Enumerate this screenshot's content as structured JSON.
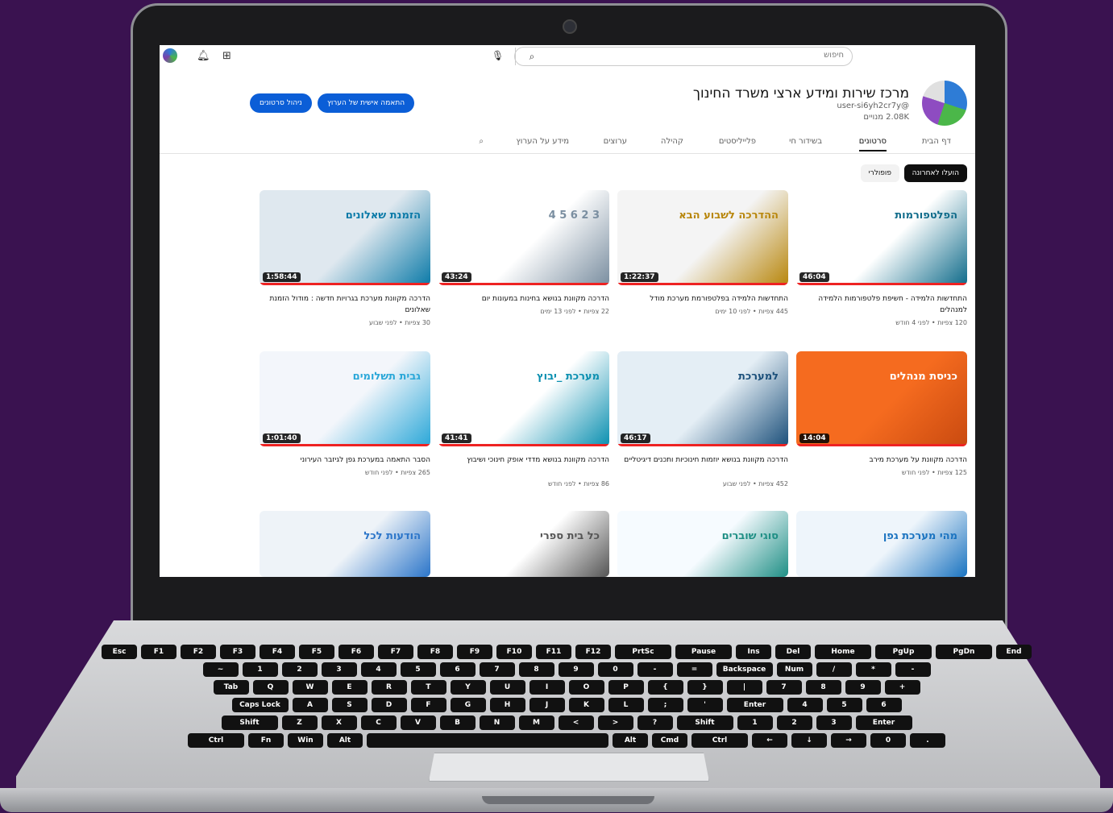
{
  "topbar": {
    "search_placeholder": "חיפוש",
    "icons": [
      "create-video-icon",
      "bell-icon",
      "mic-icon",
      "search-icon"
    ]
  },
  "channel": {
    "name": "מרכז שירות ומידע ארצי משרד החינוך",
    "handle": "@user-si6yh2cr7y",
    "subscribers": "2.08K מנויים",
    "customize_button": "התאמה אישית של הערוץ",
    "manage_button": "ניהול סרטונים"
  },
  "tabs": [
    {
      "label": "דף הבית"
    },
    {
      "label": "סרטונים"
    },
    {
      "label": "בשידור חי"
    },
    {
      "label": "פלייליסטים"
    },
    {
      "label": "קהילה"
    },
    {
      "label": "ערוצים"
    },
    {
      "label": "מידע על הערוץ"
    }
  ],
  "chips": {
    "latest": "הועלו לאחרונה",
    "popular": "פופולרי"
  },
  "videos": [
    {
      "title": "התחדשות הלמידה - חשיפת פלטפורמות הלמידה למנהלים",
      "meta": "120 צפיות • לפני 4 חודש",
      "duration": "46:04",
      "thumb_text": "הפלטפורמות"
    },
    {
      "title": "התחדשות הלמידה בפלטפורמת מערכת מודל",
      "meta": "445 צפיות • לפני 10 ימים",
      "duration": "1:22:37",
      "thumb_text": "ההדרכה לשבוע הבא"
    },
    {
      "title": "הדרכה מקוונת בנושא בחינות במעונות יום",
      "meta": "22 צפיות • לפני 13 ימים",
      "duration": "43:24",
      "thumb_text": "3 2 6 5 4"
    },
    {
      "title": "הדרכה מקוונת מערכת בגרויות חדשה : מודול הזמנת שאלונים",
      "meta": "30 צפיות • לפני שבוע",
      "duration": "1:58:44",
      "thumb_text": "הזמנת שאלונים"
    },
    {
      "title": "הדרכה מקוונת על מערכת מירב",
      "meta": "125 צפיות • לפני חודש",
      "duration": "14:04",
      "thumb_text": "כניסת מנהלים"
    },
    {
      "title": "הדרכה מקוונת בנושא יוזמות חינוכיות ותכנים דיגיטליים",
      "meta": "452 צפיות • לפני שבוע",
      "duration": "46:17",
      "thumb_text": "למערכת"
    },
    {
      "title": "הדרכה מקוונת בנושא מדדי אופק חינוכי ושיבוץ",
      "meta": "86 צפיות • לפני חודש",
      "duration": "41:41",
      "thumb_text": "מערכת _יבוץ"
    },
    {
      "title": "הסבר התאמה במערכת גפן לגיזבר העירוני",
      "meta": "265 צפיות • לפני חודש",
      "duration": "1:01:40",
      "thumb_text": "גבית תשלומים"
    },
    {
      "title": "",
      "meta": "",
      "duration": "",
      "thumb_text": "מהי מערכת גפן"
    },
    {
      "title": "",
      "meta": "",
      "duration": "",
      "thumb_text": "סוגי שוברים"
    },
    {
      "title": "",
      "meta": "",
      "duration": "",
      "thumb_text": "כל בית ספרי"
    },
    {
      "title": "",
      "meta": "",
      "duration": "",
      "thumb_text": "הודעות לכל"
    }
  ],
  "keyboard": {
    "row1": [
      "Esc",
      "F1",
      "F2",
      "F3",
      "F4",
      "F5",
      "F6",
      "F7",
      "F8",
      "F9",
      "F10",
      "F11",
      "F12",
      "PrtSc",
      "Pause",
      "Ins",
      "Del",
      "Home",
      "PgUp",
      "PgDn",
      "End"
    ],
    "row2": [
      "~",
      "1",
      "2",
      "3",
      "4",
      "5",
      "6",
      "7",
      "8",
      "9",
      "0",
      "-",
      "=",
      "Backspace",
      "Num",
      "/",
      "*",
      "-"
    ],
    "row3": [
      "Tab",
      "Q",
      "W",
      "E",
      "R",
      "T",
      "Y",
      "U",
      "I",
      "O",
      "P",
      "{",
      "}",
      "|",
      "7",
      "8",
      "9",
      "+"
    ],
    "row4": [
      "Caps Lock",
      "A",
      "S",
      "D",
      "F",
      "G",
      "H",
      "J",
      "K",
      "L",
      ";",
      "'",
      "Enter",
      "4",
      "5",
      "6"
    ],
    "row5": [
      "Shift",
      "Z",
      "X",
      "C",
      "V",
      "B",
      "N",
      "M",
      "<",
      ">",
      "?",
      "Shift",
      "1",
      "2",
      "3",
      "Enter"
    ],
    "row6": [
      "Ctrl",
      "Fn",
      "Win",
      "Alt",
      "",
      "Alt",
      "Cmd",
      "Ctrl",
      "←",
      "↓",
      "→",
      "0",
      "."
    ]
  },
  "colors": {
    "background": "#3a1250",
    "accent": "#0b5ed7",
    "progress": "#e22222"
  }
}
